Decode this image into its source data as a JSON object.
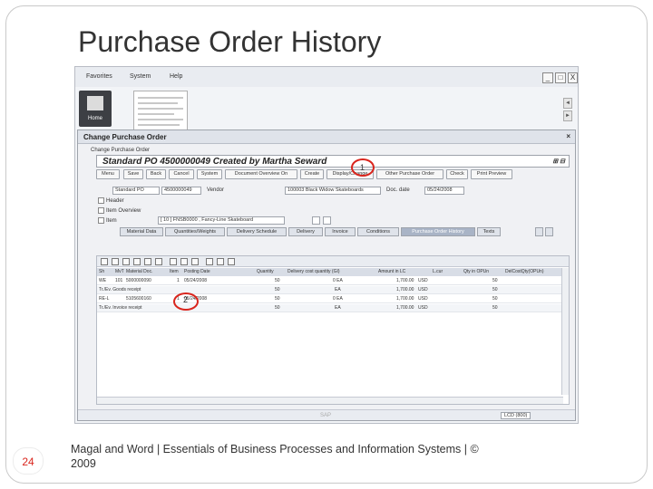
{
  "slide": {
    "title": "Purchase Order History",
    "page_number": "24",
    "footer": "Magal and Word | Essentials of Business Processes and Information Systems | © 2009"
  },
  "sap_window": {
    "menu": [
      "Favorites",
      "System",
      "Help"
    ],
    "window_buttons": [
      "_",
      "□",
      "X"
    ],
    "home_tile_label": "Home",
    "scroll_arrows": [
      "◄",
      "►"
    ],
    "dialog": {
      "title": "Change Purchase Order",
      "close": "×",
      "subtitle": "Change Purchase Order",
      "po_title": "Standard PO 4500000049 Created by Martha Seward",
      "po_title_icons": "⊞ ⊟",
      "toolbar": [
        "Menu",
        "Save",
        "Back",
        "Cancel",
        "System",
        "Document Overview On",
        "Create",
        "Display/Change",
        "Other Purchase Order",
        "Check",
        "Print Preview"
      ],
      "doc_type": "Standard PO",
      "po_number": "4500000049",
      "vendor_label": "Vendor",
      "vendor_value": "100003 Black Widow Skateboards",
      "doc_date_label": "Doc. date",
      "doc_date_value": "05/24/2008",
      "header_label": "Header",
      "item_overview_label": "Item Overview",
      "item_label": "Item",
      "item_value": "[ 10 ] FNSB0000 , Fancy-Line Skateboard",
      "tabs": [
        "Material Data",
        "Quantities/Weights",
        "Delivery Schedule",
        "Delivery",
        "Invoice",
        "Conditions",
        "Purchase Order History",
        "Texts"
      ],
      "active_tab": "Purchase Order History",
      "grid": {
        "columns": [
          "Sh",
          "MvT",
          "Material Doc.",
          "Item",
          "Posting Date",
          "Quantity",
          "Delivery cost quantity (GI)",
          "Amount in LC",
          "L.cur",
          "Qty in OPUn",
          "DelCostQty(OPUn)"
        ],
        "rows": [
          {
            "sh": "WE",
            "mvt": "101",
            "doc": "5000000090",
            "item": "1",
            "date": "05/24/2008",
            "qty": "50",
            "dcq": "0 EA",
            "amount": "1,700.00",
            "cur": "USD",
            "qopun": "50"
          },
          {
            "sh": "Tr./Ev. Goods receipt",
            "mvt": "",
            "doc": "",
            "item": "",
            "date": "",
            "qty": "50",
            "dcq": "EA",
            "amount": "1,700.00",
            "cur": "USD",
            "qopun": "50"
          },
          {
            "sh": "RE-L",
            "mvt": "",
            "doc": "5105600160",
            "item": "1",
            "date": "05/24/2008",
            "qty": "50",
            "dcq": "0 EA",
            "amount": "1,700.00",
            "cur": "USD",
            "qopun": "50"
          },
          {
            "sh": "Tr./Ev. Invoice receipt",
            "mvt": "",
            "doc": "",
            "item": "",
            "date": "",
            "qty": "50",
            "dcq": "EA",
            "amount": "1,700.00",
            "cur": "USD",
            "qopun": "50"
          }
        ]
      },
      "status_value": "LCD (800)"
    },
    "callouts": [
      "1",
      "2"
    ],
    "logo_text": "SAP"
  }
}
